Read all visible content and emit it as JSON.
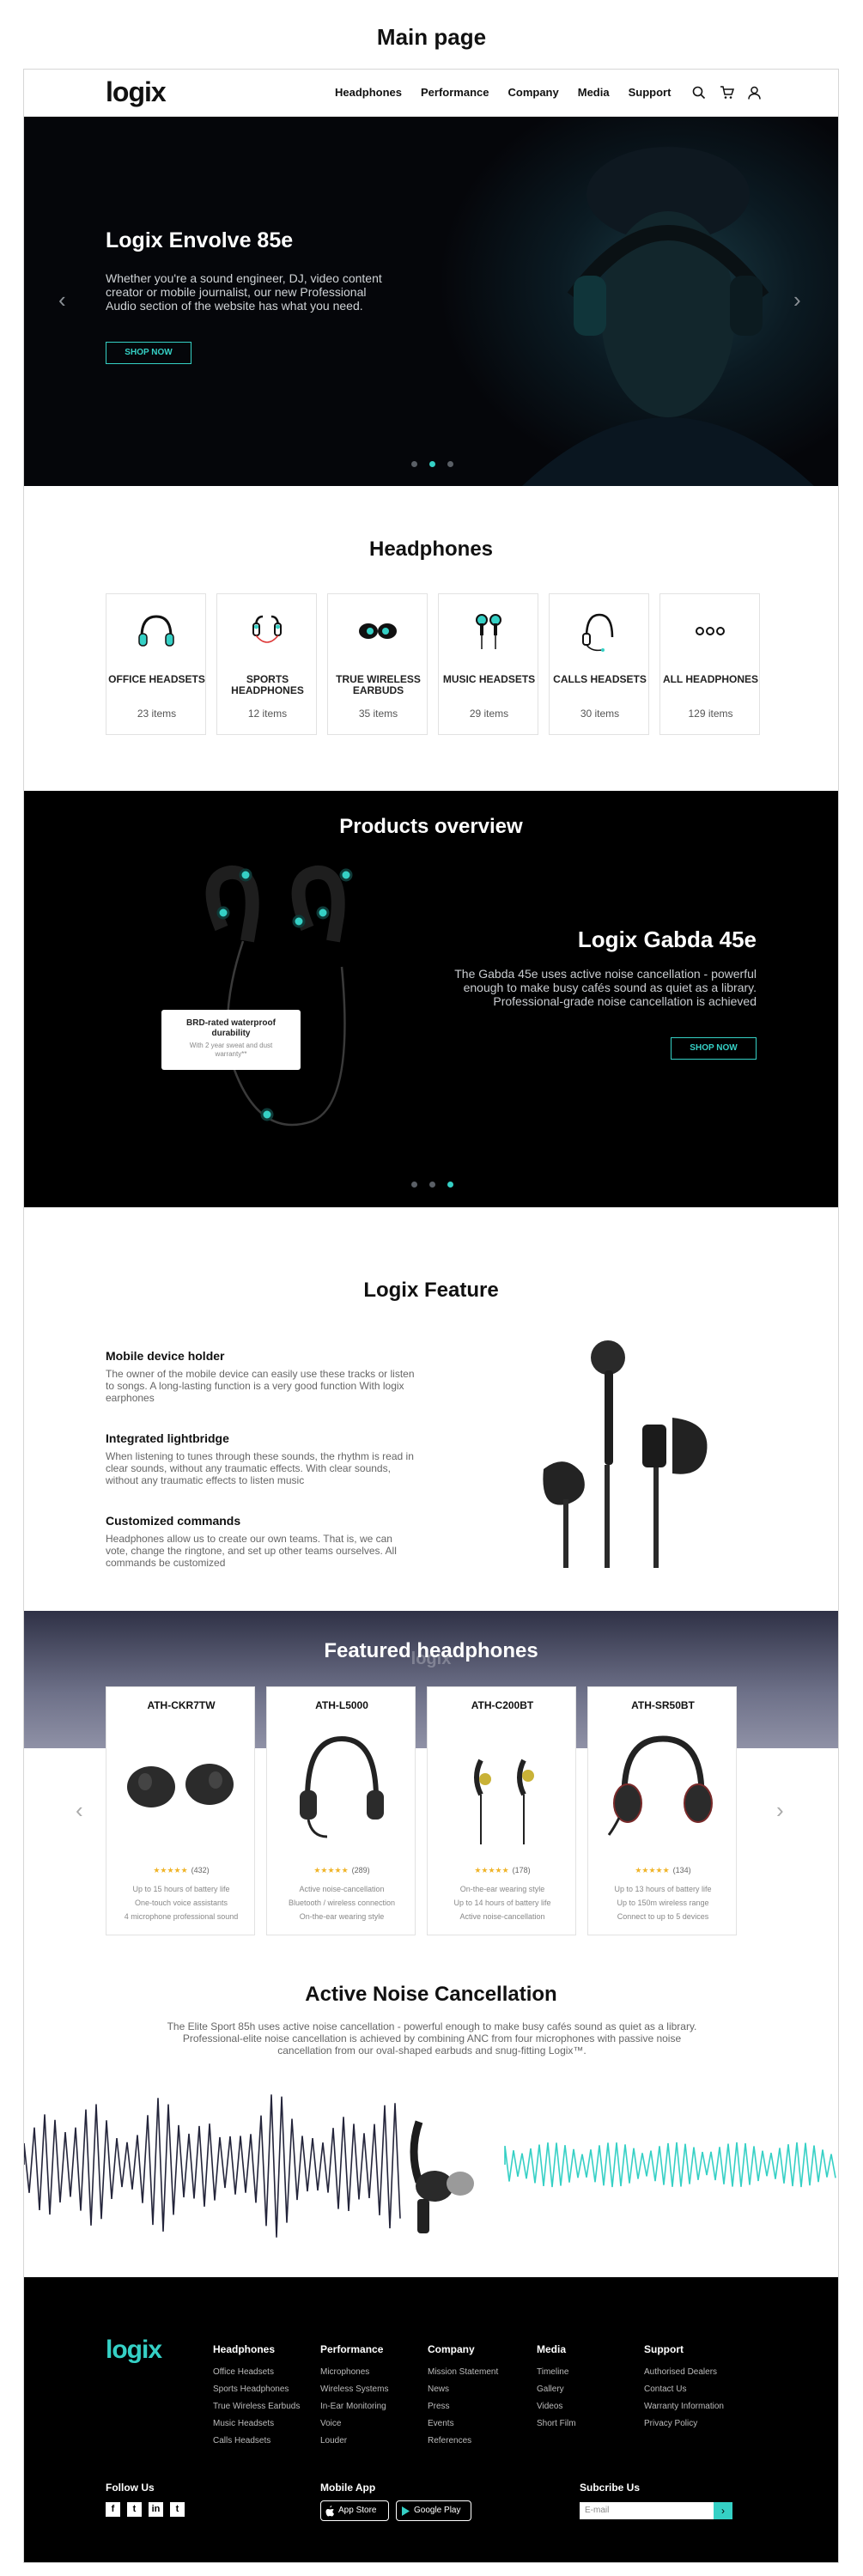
{
  "caption": "Main page",
  "header": {
    "logo": "logix",
    "nav": [
      "Headphones",
      "Performance",
      "Company",
      "Media",
      "Support"
    ]
  },
  "hero": {
    "title": "Logix Envolve 85e",
    "text": "Whether you're a sound engineer, DJ, video content creator or mobile journalist, our new Professional Audio section of the website has what you need.",
    "button": "SHOP NOW",
    "prev": "‹",
    "next": "›"
  },
  "headphones": {
    "title": "Headphones",
    "categories": [
      {
        "name": "OFFICE HEADSETS",
        "count": "23 items",
        "icon": "office-headset-icon"
      },
      {
        "name": "SPORTS HEADPHONES",
        "count": "12 items",
        "icon": "sports-headphone-icon"
      },
      {
        "name": "TRUE WIRELESS EARBUDS",
        "count": "35 items",
        "icon": "wireless-earbuds-icon"
      },
      {
        "name": "MUSIC HEADSETS",
        "count": "29 items",
        "icon": "music-headset-icon"
      },
      {
        "name": "CALLS HEADSETS",
        "count": "30 items",
        "icon": "calls-headset-icon"
      },
      {
        "name": "ALL HEADPHONES",
        "count": "129 items",
        "icon": "more-dots-icon"
      }
    ]
  },
  "overview": {
    "title": "Products overview",
    "product": "Logix Gabda 45e",
    "text": "The Gabda 45e uses active noise cancellation - powerful enough to make busy cafés sound as quiet as a library. Professional-grade noise cancellation is achieved",
    "button": "SHOP NOW",
    "tooltip_title": "BRD-rated waterproof durability",
    "tooltip_sub": "With 2 year sweat and dust warranty**"
  },
  "features": {
    "title": "Logix Feature",
    "items": [
      {
        "title": "Mobile device holder",
        "text": "The owner of the mobile device can easily use these tracks or listen to songs. A long-lasting function is a very good function With logix earphones"
      },
      {
        "title": "Integrated lightbridge",
        "text": "When listening to tunes through these sounds, the rhythm is read in clear sounds, without any traumatic effects. With clear sounds, without any traumatic effects to listen music"
      },
      {
        "title": "Customized commands",
        "text": "Headphones allow us to create our own teams. That is, we can vote, change the ringtone, and set up other teams ourselves. All commands be customized"
      }
    ]
  },
  "featured": {
    "title": "Featured headphones",
    "watermark": "logix",
    "products": [
      {
        "name": "ATH-CKR7TW",
        "stars": "★★★★★",
        "reviews": "(432)",
        "lines": [
          "Up to 15 hours of battery life",
          "One-touch voice assistants",
          "4 microphone professional sound"
        ]
      },
      {
        "name": "ATH-L5000",
        "stars": "★★★★★",
        "reviews": "(289)",
        "lines": [
          "Active noise-cancellation",
          "Bluetooth / wireless connection",
          "On-the-ear wearing style"
        ]
      },
      {
        "name": "ATH-C200BT",
        "stars": "★★★★★",
        "reviews": "(178)",
        "lines": [
          "On-the-ear wearing style",
          "Up to 14 hours of battery life",
          "Active noise-cancellation"
        ]
      },
      {
        "name": "ATH-SR50BT",
        "stars": "★★★★★",
        "reviews": "(134)",
        "lines": [
          "Up to 13 hours of battery life",
          "Up to 150m wireless range",
          "Connect to up to 5 devices"
        ]
      }
    ]
  },
  "anc": {
    "title": "Active Noise Cancellation",
    "text": "The Elite Sport 85h uses active noise cancellation - powerful enough to make busy cafés sound as quiet as a library. Professional-elite noise cancellation is achieved by combining ANC from four microphones with passive noise cancellation from our oval-shaped earbuds and snug-fitting Logix™."
  },
  "footer": {
    "logo": "logix",
    "columns": [
      {
        "title": "Headphones",
        "items": [
          "Office Headsets",
          "Sports Headphones",
          "True Wireless Earbuds",
          "Music Headsets",
          "Calls Headsets"
        ]
      },
      {
        "title": "Performance",
        "items": [
          "Microphones",
          "Wireless Systems",
          "In-Ear Monitoring",
          "Voice",
          "Louder"
        ]
      },
      {
        "title": "Company",
        "items": [
          "Mission Statement",
          "News",
          "Press",
          "Events",
          "References"
        ]
      },
      {
        "title": "Media",
        "items": [
          "Timeline",
          "Gallery",
          "Videos",
          "Short Film"
        ]
      },
      {
        "title": "Support",
        "items": [
          "Authorised Dealers",
          "Contact Us",
          "Warranty Information",
          "Privacy Policy"
        ]
      }
    ],
    "follow": "Follow Us",
    "social": [
      "f",
      "t",
      "in",
      "t"
    ],
    "mobile_app": "Mobile App",
    "app_store": "App Store",
    "google_play": "Google Play",
    "subscribe": "Subcribe Us",
    "email_placeholder": "E-mail",
    "go": "›"
  },
  "colors": {
    "accent": "#35d0c5",
    "dark": "#000000"
  }
}
